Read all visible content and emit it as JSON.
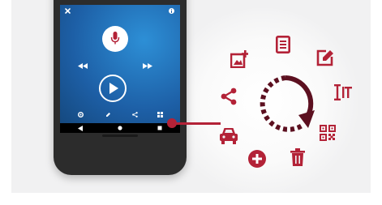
{
  "colors": {
    "accent": "#b32237",
    "screen": "#1d5fa6",
    "background": "#f1f1f2"
  },
  "phone": {
    "screen_icons": [
      "close-icon",
      "info-icon",
      "microphone-icon",
      "rewind-icon",
      "fast-forward-icon",
      "play-icon",
      "settings-icon",
      "edit-icon",
      "share-icon",
      "grid-icon"
    ],
    "nav_icons": [
      "back-icon",
      "home-icon",
      "recent-apps-icon"
    ]
  },
  "feature_icons": [
    "add-image-icon",
    "document-icon",
    "edit-icon",
    "text-cursor-icon",
    "qr-code-icon",
    "trash-icon",
    "add-circle-icon",
    "car-icon",
    "share-icon",
    "cycle-arrow-icon"
  ]
}
